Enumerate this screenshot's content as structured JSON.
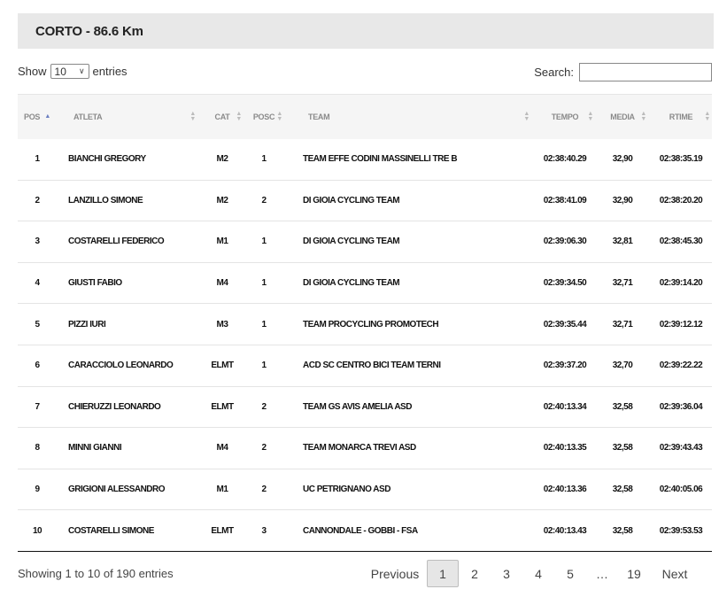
{
  "title": "CORTO - 86.6 Km",
  "controls": {
    "show_label": "Show",
    "entries_value": "10",
    "entries_label": "entries",
    "search_label": "Search:",
    "search_value": ""
  },
  "table": {
    "headers": [
      "POS",
      "ATLETA",
      "CAT",
      "POSC",
      "TEAM",
      "TEMPO",
      "MEDIA",
      "RTIME"
    ],
    "rows": [
      [
        "1",
        "BIANCHI GREGORY",
        "M2",
        "1",
        "TEAM EFFE CODINI MASSINELLI TRE B",
        "02:38:40.29",
        "32,90",
        "02:38:35.19"
      ],
      [
        "2",
        "LANZILLO SIMONE",
        "M2",
        "2",
        "DI GIOIA CYCLING TEAM",
        "02:38:41.09",
        "32,90",
        "02:38:20.20"
      ],
      [
        "3",
        "COSTARELLI FEDERICO",
        "M1",
        "1",
        "DI GIOIA CYCLING TEAM",
        "02:39:06.30",
        "32,81",
        "02:38:45.30"
      ],
      [
        "4",
        "GIUSTI FABIO",
        "M4",
        "1",
        "DI GIOIA CYCLING TEAM",
        "02:39:34.50",
        "32,71",
        "02:39:14.20"
      ],
      [
        "5",
        "PIZZI IURI",
        "M3",
        "1",
        "TEAM PROCYCLING PROMOTECH",
        "02:39:35.44",
        "32,71",
        "02:39:12.12"
      ],
      [
        "6",
        "CARACCIOLO LEONARDO",
        "ELMT",
        "1",
        "ACD SC CENTRO BICI TEAM TERNI",
        "02:39:37.20",
        "32,70",
        "02:39:22.22"
      ],
      [
        "7",
        "CHIERUZZI LEONARDO",
        "ELMT",
        "2",
        "TEAM GS AVIS AMELIA ASD",
        "02:40:13.34",
        "32,58",
        "02:39:36.04"
      ],
      [
        "8",
        "MINNI GIANNI",
        "M4",
        "2",
        "TEAM MONARCA TREVI ASD",
        "02:40:13.35",
        "32,58",
        "02:39:43.43"
      ],
      [
        "9",
        "GRIGIONI ALESSANDRO",
        "M1",
        "2",
        "UC PETRIGNANO ASD",
        "02:40:13.36",
        "32,58",
        "02:40:05.06"
      ],
      [
        "10",
        "COSTARELLI SIMONE",
        "ELMT",
        "3",
        "CANNONDALE - GOBBI - FSA",
        "02:40:13.43",
        "32,58",
        "02:39:53.53"
      ]
    ]
  },
  "footer": {
    "info": "Showing 1 to 10 of 190 entries",
    "previous": "Previous",
    "pages": [
      "1",
      "2",
      "3",
      "4",
      "5"
    ],
    "ellipsis": "…",
    "last_page": "19",
    "next": "Next",
    "current_page": "1"
  },
  "colors": {
    "title_bg": "#e8e8e8",
    "header_bg": "#f5f5f5",
    "sort_active": "#6a7ec0",
    "current_page_bg": "#e6e6e6"
  }
}
